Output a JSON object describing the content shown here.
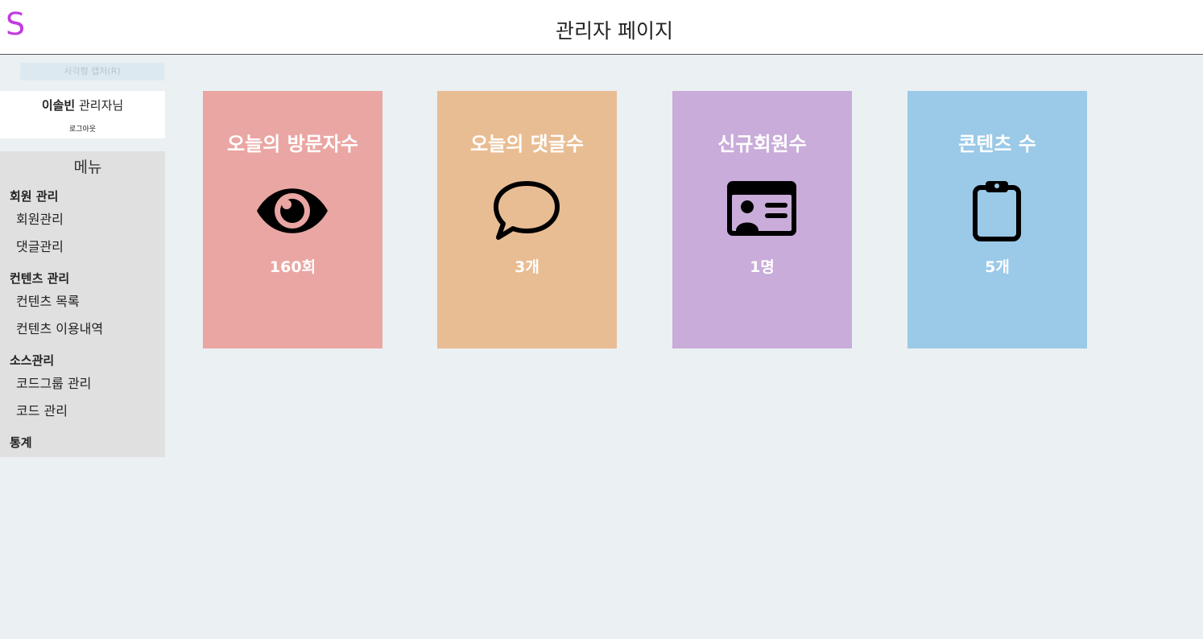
{
  "app": {
    "logo": "S",
    "title": "관리자 페이지"
  },
  "capture_button": {
    "label": "사각형 캡처(R)"
  },
  "user": {
    "name": "이솔빈",
    "suffix": " 관리자님",
    "logout": "로그아웃"
  },
  "sidebar": {
    "menu_title": "메뉴",
    "groups": [
      {
        "label": "회원 관리",
        "items": [
          {
            "label": "회원관리"
          },
          {
            "label": "댓글관리"
          }
        ]
      },
      {
        "label": "컨텐츠 관리",
        "items": [
          {
            "label": "컨텐츠 목록"
          },
          {
            "label": "컨텐츠 이용내역"
          }
        ]
      },
      {
        "label": "소스관리",
        "items": [
          {
            "label": "코드그룹 관리"
          },
          {
            "label": "코드 관리"
          }
        ]
      },
      {
        "label": "통계",
        "items": []
      }
    ]
  },
  "cards": [
    {
      "title": "오늘의 방문자수",
      "value": "160회",
      "icon": "eye-icon",
      "color": "#eaa6a3"
    },
    {
      "title": "오늘의 댓글수",
      "value": "3개",
      "icon": "chat-bubble-icon",
      "color": "#e9bd93"
    },
    {
      "title": "신규회원수",
      "value": "1명",
      "icon": "id-card-icon",
      "color": "#c9acd9"
    },
    {
      "title": "콘텐츠 수",
      "value": "5개",
      "icon": "clipboard-icon",
      "color": "#9bc9e8"
    }
  ]
}
